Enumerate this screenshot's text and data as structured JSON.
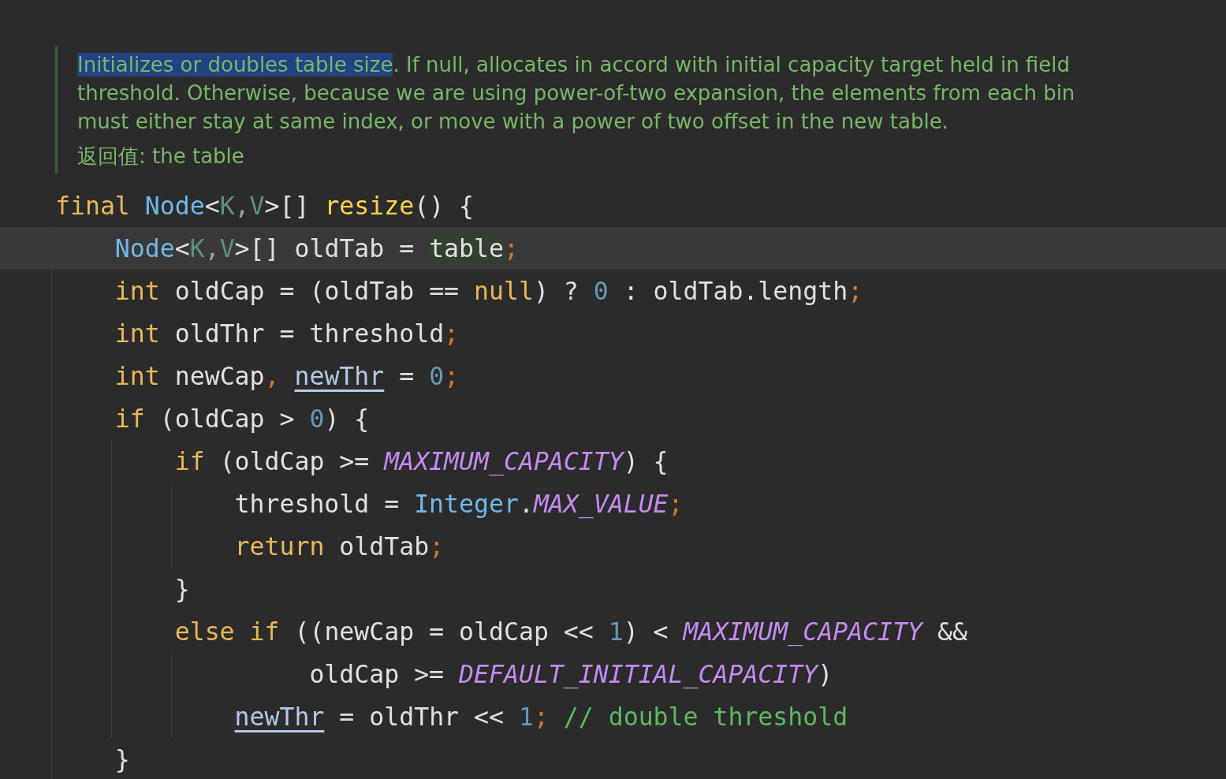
{
  "doc_comment": {
    "lines": [
      [
        {
          "text": "Initializes or doubles table size",
          "selected": true
        },
        {
          "text": ". If null, allocates in accord with initial capacity target held in field",
          "selected": false
        }
      ],
      [
        {
          "text": "threshold. Otherwise, because we are using power-of-two expansion, the elements from each bin",
          "selected": false
        }
      ],
      [
        {
          "text": "must either stay at same index, or move with a power of two offset in the new table.",
          "selected": false
        }
      ]
    ],
    "returns": "返回值: the table"
  },
  "code_lines": [
    {
      "current": false,
      "tokens": [
        {
          "kind": "keyword",
          "t": "final"
        },
        {
          "kind": "type",
          "t": " Node"
        },
        {
          "kind": "plain",
          "t": "<"
        },
        {
          "kind": "generic",
          "t": "K"
        },
        {
          "kind": "punct",
          "t": ","
        },
        {
          "kind": "generic",
          "t": "V"
        },
        {
          "kind": "plain",
          "t": ">[]"
        },
        {
          "kind": "method",
          "t": " resize"
        },
        {
          "kind": "plain",
          "t": "() {"
        }
      ]
    },
    {
      "current": true,
      "tokens": [
        {
          "kind": "type",
          "t": "    Node"
        },
        {
          "kind": "plain",
          "t": "<"
        },
        {
          "kind": "generic",
          "t": "K"
        },
        {
          "kind": "punct",
          "t": ","
        },
        {
          "kind": "generic",
          "t": "V"
        },
        {
          "kind": "plain",
          "t": ">[] oldTab = "
        },
        {
          "kind": "usage",
          "t": "table"
        },
        {
          "kind": "semi",
          "t": ";"
        }
      ]
    },
    {
      "current": false,
      "tokens": [
        {
          "kind": "keyword",
          "t": "    int"
        },
        {
          "kind": "plain",
          "t": " oldCap = (oldTab == "
        },
        {
          "kind": "keyword",
          "t": "null"
        },
        {
          "kind": "plain",
          "t": ") ? "
        },
        {
          "kind": "number",
          "t": "0"
        },
        {
          "kind": "plain",
          "t": " : oldTab.length"
        },
        {
          "kind": "semi",
          "t": ";"
        }
      ]
    },
    {
      "current": false,
      "tokens": [
        {
          "kind": "keyword",
          "t": "    int"
        },
        {
          "kind": "plain",
          "t": " oldThr = threshold"
        },
        {
          "kind": "semi",
          "t": ";"
        }
      ]
    },
    {
      "current": false,
      "tokens": [
        {
          "kind": "keyword",
          "t": "    int"
        },
        {
          "kind": "plain",
          "t": " newCap"
        },
        {
          "kind": "semi",
          "t": ","
        },
        {
          "kind": "reassigned",
          "t": " newThr"
        },
        {
          "kind": "plain",
          "t": " = "
        },
        {
          "kind": "number",
          "t": "0"
        },
        {
          "kind": "semi",
          "t": ";"
        }
      ]
    },
    {
      "current": false,
      "tokens": [
        {
          "kind": "keyword",
          "t": "    if"
        },
        {
          "kind": "plain",
          "t": " (oldCap > "
        },
        {
          "kind": "number",
          "t": "0"
        },
        {
          "kind": "plain",
          "t": ") {"
        }
      ]
    },
    {
      "current": false,
      "tokens": [
        {
          "kind": "keyword",
          "t": "        if"
        },
        {
          "kind": "plain",
          "t": " (oldCap >= "
        },
        {
          "kind": "constant",
          "t": "MAXIMUM_CAPACITY"
        },
        {
          "kind": "plain",
          "t": ") {"
        }
      ]
    },
    {
      "current": false,
      "tokens": [
        {
          "kind": "plain",
          "t": "            threshold = "
        },
        {
          "kind": "type",
          "t": "Integer"
        },
        {
          "kind": "plain",
          "t": "."
        },
        {
          "kind": "constant",
          "t": "MAX_VALUE"
        },
        {
          "kind": "semi",
          "t": ";"
        }
      ]
    },
    {
      "current": false,
      "tokens": [
        {
          "kind": "keyword",
          "t": "            return"
        },
        {
          "kind": "plain",
          "t": " oldTab"
        },
        {
          "kind": "semi",
          "t": ";"
        }
      ]
    },
    {
      "current": false,
      "tokens": [
        {
          "kind": "plain",
          "t": "        }"
        }
      ]
    },
    {
      "current": false,
      "tokens": [
        {
          "kind": "keyword",
          "t": "        else if"
        },
        {
          "kind": "plain",
          "t": " ((newCap = oldCap << "
        },
        {
          "kind": "number",
          "t": "1"
        },
        {
          "kind": "plain",
          "t": ") < "
        },
        {
          "kind": "constant",
          "t": "MAXIMUM_CAPACITY"
        },
        {
          "kind": "plain",
          "t": " &&"
        }
      ]
    },
    {
      "current": false,
      "tokens": [
        {
          "kind": "plain",
          "t": "                 oldCap >= "
        },
        {
          "kind": "constant",
          "t": "DEFAULT_INITIAL_CAPACITY"
        },
        {
          "kind": "plain",
          "t": ")"
        }
      ]
    },
    {
      "current": false,
      "tokens": [
        {
          "kind": "reassigned",
          "t": "            newThr"
        },
        {
          "kind": "plain",
          "t": " = oldThr << "
        },
        {
          "kind": "number",
          "t": "1"
        },
        {
          "kind": "semi",
          "t": ";"
        },
        {
          "kind": "comment",
          "t": " // double threshold"
        }
      ]
    },
    {
      "current": false,
      "tokens": [
        {
          "kind": "plain",
          "t": "    }"
        }
      ]
    }
  ]
}
